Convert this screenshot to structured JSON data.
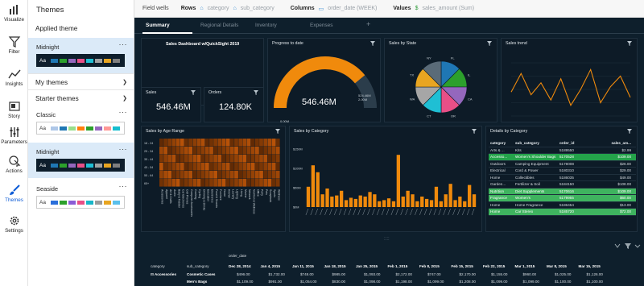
{
  "rail": {
    "items": [
      {
        "label": "Visualize",
        "icon": "bar-chart-icon"
      },
      {
        "label": "Filter",
        "icon": "funnel-icon"
      },
      {
        "label": "Insights",
        "icon": "line-chart-icon"
      },
      {
        "label": "Story",
        "icon": "story-icon"
      },
      {
        "label": "Parameters",
        "icon": "sliders-icon"
      },
      {
        "label": "Actions",
        "icon": "pointer-icon"
      },
      {
        "label": "Themes",
        "icon": "brush-icon",
        "active": true
      },
      {
        "label": "Settings",
        "icon": "gear-icon"
      }
    ]
  },
  "panel": {
    "title": "Themes",
    "applied_label": "Applied theme",
    "my_themes_label": "My themes",
    "starter_label": "Starter themes",
    "themes": {
      "applied": {
        "name": "Midnight",
        "more": "···",
        "aa": "Aa",
        "colors": [
          "#1f77b4",
          "#2ca02c",
          "#9467bd",
          "#e84f87",
          "#1fbfd4",
          "#a1a1a1",
          "#e8a521",
          "#7f7f7f"
        ]
      },
      "classic": {
        "name": "Classic",
        "more": "···",
        "aa": "Aa",
        "colors": [
          "#aec7e8",
          "#1f77b4",
          "#98df8a",
          "#ff7f0e",
          "#2ca02c",
          "#9467bd",
          "#ff9896",
          "#17becf"
        ]
      },
      "midnight": {
        "name": "Midnight",
        "more": "···",
        "aa": "Aa",
        "colors": [
          "#1f77b4",
          "#2ca02c",
          "#9467bd",
          "#e84f87",
          "#1fbfd4",
          "#a1a1a1",
          "#e8a521",
          "#7f7f7f"
        ]
      },
      "seaside": {
        "name": "Seaside",
        "more": "···",
        "aa": "Aa",
        "colors": [
          "#2a6fdb",
          "#2ca02c",
          "#8a5cd6",
          "#e84f87",
          "#18b6c9",
          "#9b9b9b",
          "#e8a521",
          "#5bc0eb"
        ]
      }
    }
  },
  "topbar": {
    "field_wells": "Field wells",
    "rows_label": "Rows",
    "rows_values": [
      "category",
      "sub_category"
    ],
    "columns_label": "Columns",
    "columns_value": "order_date (WEEK)",
    "values_label": "Values",
    "values_value": "sales_amount (Sum)"
  },
  "tabs": [
    {
      "label": "Summary",
      "active": true
    },
    {
      "label": "Regional Details"
    },
    {
      "label": "Inventory"
    },
    {
      "label": "Expenses"
    }
  ],
  "add_tab": "+",
  "visuals": {
    "title_card": "Sales Dashboard w/QuickSight 2019",
    "progress": {
      "title": "Progress to date",
      "value": "546.46M",
      "min": "0.00M",
      "target": "524.46M",
      "target2": "2.00M",
      "fraction": 0.78
    },
    "state": {
      "title": "Sales by State",
      "labels": [
        "FL",
        "IL",
        "CA",
        "OR",
        "CT",
        "WA",
        "TX",
        "NY"
      ],
      "colors": [
        "#1f77b4",
        "#2ca02c",
        "#9467bd",
        "#e84f87",
        "#1fbfd4",
        "#a6a6a6",
        "#e8a521",
        "#5a6b78"
      ]
    },
    "trend": {
      "title": "Sales trend",
      "values": [
        18,
        32,
        16,
        25,
        12,
        28,
        8,
        20,
        35,
        10,
        22,
        30,
        14
      ]
    },
    "sales": {
      "title": "Sales",
      "value": "546.46M"
    },
    "orders": {
      "title": "Orders",
      "value": "124.80K"
    },
    "age": {
      "title": "Sales by Age Range",
      "rows": [
        "18 - 24",
        "25 - 34",
        "35 - 44",
        "45 - 54",
        "55 - 64",
        "65+"
      ],
      "cols": [
        "Accessories",
        "Apparel",
        "Art & Crafts",
        "Audio",
        "Baby & Toddler",
        "Car Electronics",
        "Cell Phones",
        "Computer Accessories",
        "Cooking",
        "Cycling",
        "Drinking & Drinks",
        "Education",
        "Electronics",
        "Food & Snacks",
        "Furniture",
        "Home",
        "Kitchen",
        "Laundry",
        "Lighting",
        "Living",
        "Marine",
        "Network",
        "Nutrition & Wellness",
        "Office",
        "Party",
        "Pets",
        "Scrapbook",
        "Sports",
        "Wellness"
      ]
    },
    "category": {
      "title": "Sales by Category",
      "ytick_top": "$150M",
      "ytick_mid": "$100M",
      "ytick_low": "$50M",
      "ytick_zero": "$0M",
      "values": [
        35,
        72,
        60,
        22,
        32,
        18,
        20,
        28,
        12,
        16,
        14,
        20,
        18,
        26,
        22,
        10,
        12,
        15,
        10,
        90,
        18,
        28,
        22,
        10,
        18,
        14,
        12,
        35,
        10,
        22,
        40,
        12,
        18,
        10,
        38,
        22
      ]
    },
    "details": {
      "title": "Details by Category",
      "headers": [
        "category",
        "sub_category",
        "order_id",
        "sales_am..."
      ],
      "rows": [
        {
          "c": "Arts & ...",
          "s": "Kits",
          "o": "5189550",
          "v": "$2.99"
        },
        {
          "c": "Accesso...",
          "s": "Women's Shoulder Bags",
          "o": "5170528",
          "v": "$109.00",
          "hl": "sel"
        },
        {
          "c": "Outdoors",
          "s": "Camping Equipment",
          "o": "5178008",
          "v": "$26.00"
        },
        {
          "c": "Electrical",
          "s": "Cord & Power",
          "o": "5180310",
          "v": "$29.00"
        },
        {
          "c": "Home",
          "s": "Collectibles",
          "o": "5186035",
          "v": "$49.00"
        },
        {
          "c": "Garden...",
          "s": "Fertilizer & Soil",
          "o": "5184150",
          "v": "$108.00"
        },
        {
          "c": "Nutrition",
          "s": "Diet Supplements",
          "o": "5170616",
          "v": "$109.00",
          "hl": "g"
        },
        {
          "c": "Fragrance",
          "s": "Women's",
          "o": "5179955",
          "v": "$60.00",
          "hl": "g"
        },
        {
          "c": "Home",
          "s": "Home Fragrance",
          "o": "5186454",
          "v": "$13.00"
        },
        {
          "c": "Home",
          "s": "Car Stereo",
          "o": "5185720",
          "v": "$72.00",
          "hl": "g"
        }
      ]
    }
  },
  "bottom": {
    "grip": "::::",
    "col_field": "order_date",
    "row_header1": "category",
    "row_header2": "sub_category",
    "dates": [
      "Dec 28, 2014",
      "Jan 4, 2015",
      "Jan 11, 2015",
      "Jan 18, 2015",
      "Jan 25, 2015",
      "Feb 1, 2015",
      "Feb 8, 2015",
      "Feb 15, 2015",
      "Feb 22, 2015",
      "Mar 1, 2015",
      "Mar 8, 2015",
      "Mar 15, 2015"
    ],
    "category": "Accessories",
    "rows": [
      {
        "name": "Cosmetic Cases",
        "vals": [
          "$496.00",
          "$1,732.00",
          "$748.00",
          "$985.00",
          "$1,093.00",
          "$2,172.00",
          "$747.00",
          "$2,170.00",
          "$1,155.00",
          "$960.00",
          "$1,025.00",
          "$1,126.00"
        ]
      },
      {
        "name": "Men's Bags",
        "vals": [
          "$1,109.00",
          "$991.00",
          "$1,054.00",
          "$830.00",
          "$1,098.00",
          "$1,198.00",
          "$1,099.00",
          "$1,208.00",
          "$1,099.00",
          "$1,099.00",
          "$1,100.00",
          "$1,100.00"
        ]
      }
    ]
  }
}
